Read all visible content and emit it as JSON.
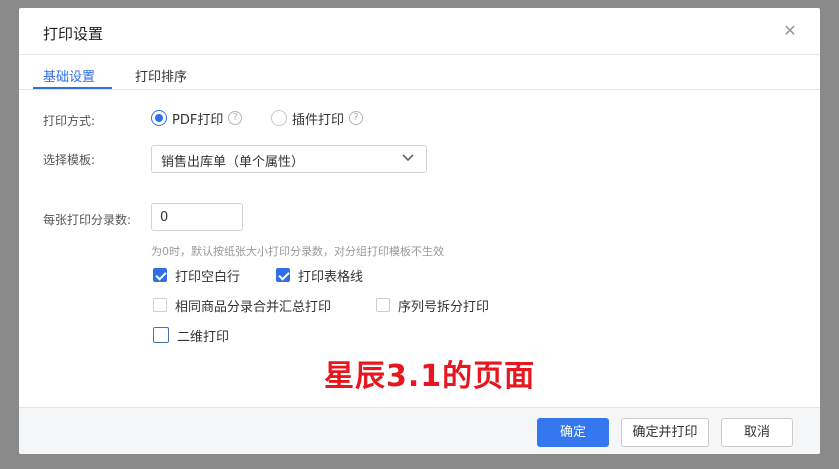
{
  "dialog": {
    "title": "打印设置",
    "close_glyph": "✕"
  },
  "tabs": [
    {
      "label": "基础设置",
      "active": true
    },
    {
      "label": "打印排序",
      "active": false
    }
  ],
  "print_method": {
    "label": "打印方式:",
    "options": [
      {
        "label": "PDF打印",
        "checked": true
      },
      {
        "label": "插件打印",
        "checked": false
      }
    ],
    "help_glyph": "?"
  },
  "template": {
    "label": "选择模板:",
    "value": "销售出库单（单个属性）"
  },
  "entries_per_sheet": {
    "label": "每张打印分录数:",
    "value": "0",
    "hint": "为0时，默认按纸张大小打印分录数，对分组打印模板不生效"
  },
  "checkboxes": [
    {
      "label": "打印空白行",
      "checked": true
    },
    {
      "label": "打印表格线",
      "checked": true
    },
    {
      "label": "相同商品分录合并汇总打印",
      "checked": false
    },
    {
      "label": "序列号拆分打印",
      "checked": false
    },
    {
      "label": "二维打印",
      "checked": false
    }
  ],
  "watermark": "星辰3.1的页面",
  "footer": {
    "confirm": "确定",
    "confirm_print": "确定并打印",
    "cancel": "取消"
  },
  "colors": {
    "accent": "#2f6fe8",
    "primary_button": "#3577ee",
    "watermark": "#e8171f",
    "overlay": "#8a8a8a"
  }
}
